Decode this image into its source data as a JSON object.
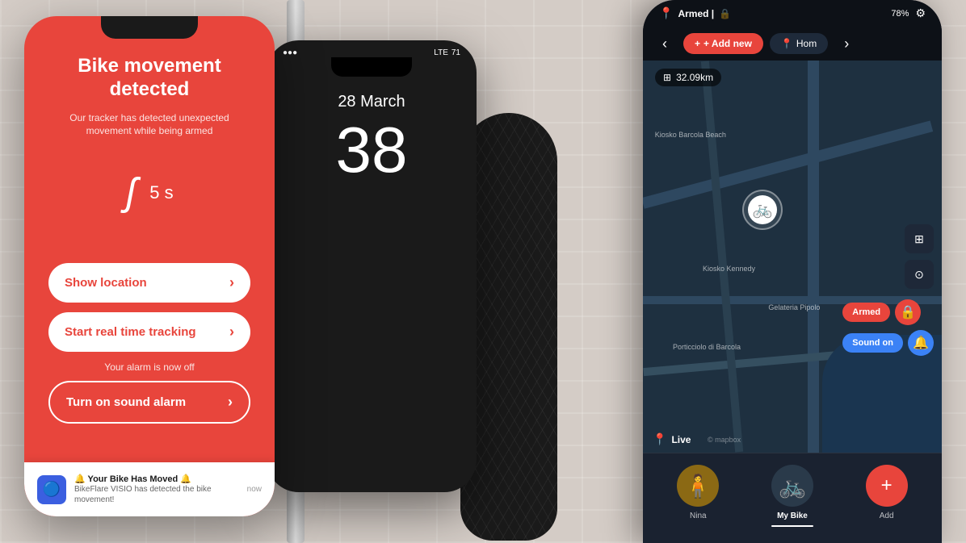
{
  "background": {
    "color": "#d4ccc6"
  },
  "phone_left": {
    "alert_title": "Bike movement detected",
    "alert_subtitle": "Our tracker has detected unexpected movement while being armed",
    "timer_seconds": "5 s",
    "btn_show_location": "Show location",
    "btn_real_time": "Start real time tracking",
    "alarm_off_text": "Your alarm is now off",
    "btn_turn_on_alarm": "Turn on sound alarm"
  },
  "notification": {
    "title": "🔔 Your Bike Has Moved 🔔",
    "body": "BikeFlare VISIO has detected the bike movement!",
    "time": "now"
  },
  "phone_center": {
    "signal": "●●●",
    "network": "LTE",
    "battery": "71",
    "date": "28 March",
    "time": "38"
  },
  "phone_right": {
    "status_armed": "Armed |",
    "battery_pct": "78%",
    "distance": "32.09km",
    "btn_add_new": "+ Add new",
    "btn_home": "Hom",
    "live_label": "Live",
    "mapbox_credit": "© mapbox",
    "chip_armed": "Armed",
    "chip_sound": "Sound on",
    "map_labels": {
      "label1": "Kiosko Barcola Beach",
      "label2": "Kiosko Kennedy",
      "label3": "Gelateria Pipolo",
      "label4": "Porticciolo di Barcola"
    },
    "bikes": [
      {
        "name": "Nina",
        "active": false,
        "emoji": "🧍"
      },
      {
        "name": "My Bike",
        "active": true,
        "emoji": "🚲"
      },
      {
        "name": "Add",
        "active": false,
        "emoji": "+"
      }
    ]
  }
}
